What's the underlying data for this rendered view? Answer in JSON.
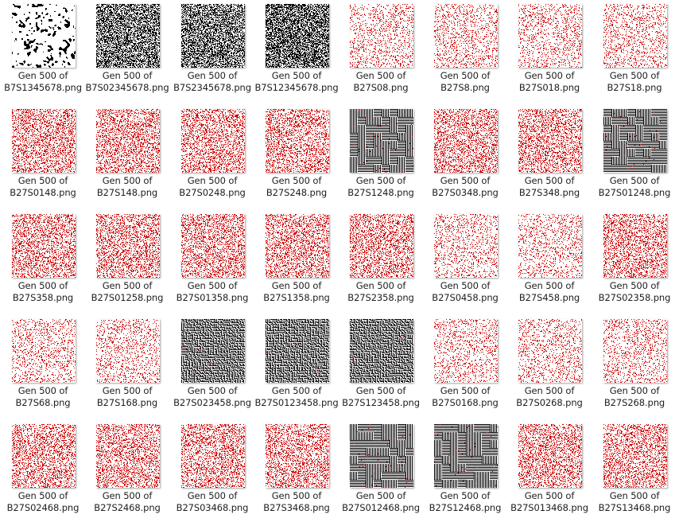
{
  "window": {
    "view": "Large icons"
  },
  "colors": {
    "red": "#cc0000",
    "black": "#000000",
    "white": "#ffffff",
    "label_text": "#1e1e1e"
  },
  "files": [
    {
      "line1": "Gen 500 of",
      "line2": "B7S1345678.png",
      "style": "bw-blobs"
    },
    {
      "line1": "Gen 500 of",
      "line2": "B7S02345678.png",
      "style": "bw-noise"
    },
    {
      "line1": "Gen 500 of",
      "line2": "B7S2345678.png",
      "style": "bw-noise"
    },
    {
      "line1": "Gen 500 of",
      "line2": "B7S12345678.png",
      "style": "bw-dense"
    },
    {
      "line1": "Gen 500 of",
      "line2": "B27S08.png",
      "style": "red-sparse"
    },
    {
      "line1": "Gen 500 of",
      "line2": "B27S8.png",
      "style": "red-sparse"
    },
    {
      "line1": "Gen 500 of",
      "line2": "B27S018.png",
      "style": "red-sparse"
    },
    {
      "line1": "Gen 500 of",
      "line2": "B27S18.png",
      "style": "red-sparse"
    },
    {
      "line1": "Gen 500 of",
      "line2": "B27S0148.png",
      "style": "red-dense"
    },
    {
      "line1": "Gen 500 of",
      "line2": "B27S148.png",
      "style": "red-dense"
    },
    {
      "line1": "Gen 500 of",
      "line2": "B27S0248.png",
      "style": "red-dense"
    },
    {
      "line1": "Gen 500 of",
      "line2": "B27S248.png",
      "style": "red-dense"
    },
    {
      "line1": "Gen 500 of",
      "line2": "B27S1248.png",
      "style": "maze-lines"
    },
    {
      "line1": "Gen 500 of",
      "line2": "B27S0348.png",
      "style": "red-dense"
    },
    {
      "line1": "Gen 500 of",
      "line2": "B27S348.png",
      "style": "red-dense"
    },
    {
      "line1": "Gen 500 of",
      "line2": "B27S01248.png",
      "style": "maze-lines"
    },
    {
      "line1": "Gen 500 of",
      "line2": "B27S358.png",
      "style": "red-dense"
    },
    {
      "line1": "Gen 500 of",
      "line2": "B27S01258.png",
      "style": "red-dense"
    },
    {
      "line1": "Gen 500 of",
      "line2": "B27S01358.png",
      "style": "red-dense"
    },
    {
      "line1": "Gen 500 of",
      "line2": "B27S1358.png",
      "style": "red-dense"
    },
    {
      "line1": "Gen 500 of",
      "line2": "B27S2358.png",
      "style": "red-dense"
    },
    {
      "line1": "Gen 500 of",
      "line2": "B27S0458.png",
      "style": "red-sparse"
    },
    {
      "line1": "Gen 500 of",
      "line2": "B27S458.png",
      "style": "red-sparse"
    },
    {
      "line1": "Gen 500 of",
      "line2": "B27S02358.png",
      "style": "red-dense"
    },
    {
      "line1": "Gen 500 of",
      "line2": "B27S68.png",
      "style": "red-sparse"
    },
    {
      "line1": "Gen 500 of",
      "line2": "B27S168.png",
      "style": "red-sparse"
    },
    {
      "line1": "Gen 500 of",
      "line2": "B27S023458.png",
      "style": "maze-fine"
    },
    {
      "line1": "Gen 500 of",
      "line2": "B27S0123458.png",
      "style": "maze-fine"
    },
    {
      "line1": "Gen 500 of",
      "line2": "B27S123458.png",
      "style": "maze-fine"
    },
    {
      "line1": "Gen 500 of",
      "line2": "B27S0168.png",
      "style": "red-sparse"
    },
    {
      "line1": "Gen 500 of",
      "line2": "B27S0268.png",
      "style": "red-sparse"
    },
    {
      "line1": "Gen 500 of",
      "line2": "B27S268.png",
      "style": "red-sparse"
    },
    {
      "line1": "Gen 500 of",
      "line2": "B27S02468.png",
      "style": "red-dense"
    },
    {
      "line1": "Gen 500 of",
      "line2": "B27S2468.png",
      "style": "red-dense"
    },
    {
      "line1": "Gen 500 of",
      "line2": "B27S03468.png",
      "style": "red-dense"
    },
    {
      "line1": "Gen 500 of",
      "line2": "B27S3468.png",
      "style": "red-dense"
    },
    {
      "line1": "Gen 500 of",
      "line2": "B27S012468.png",
      "style": "maze-lines"
    },
    {
      "line1": "Gen 500 of",
      "line2": "B27S12468.png",
      "style": "maze-lines"
    },
    {
      "line1": "Gen 500 of",
      "line2": "B27S013468.png",
      "style": "red-dense"
    },
    {
      "line1": "Gen 500 of",
      "line2": "B27S13468.png",
      "style": "red-dense"
    }
  ]
}
